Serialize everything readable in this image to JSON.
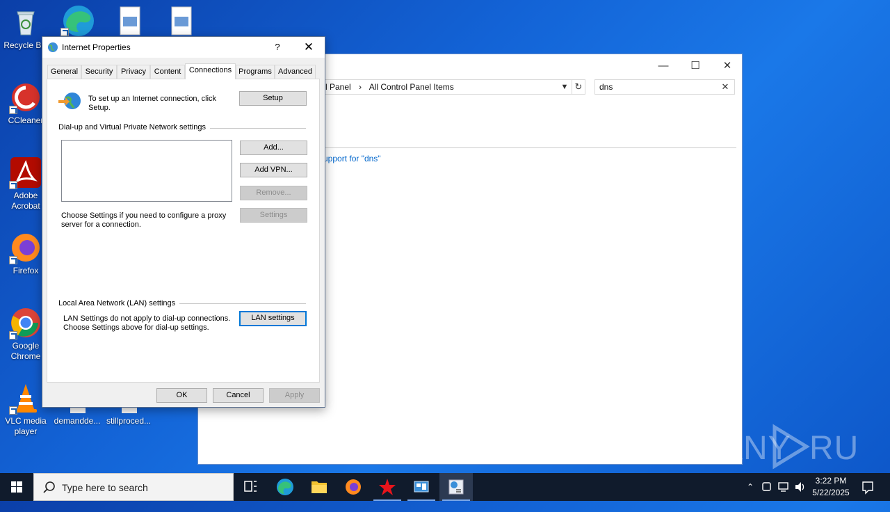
{
  "desktop": {
    "icons": [
      {
        "label": "Recycle Bin"
      },
      {
        "label": "CCleaner"
      },
      {
        "label": "Adobe Acrobat"
      },
      {
        "label": "Firefox"
      },
      {
        "label": "Google Chrome"
      },
      {
        "label": "VLC media player"
      },
      {
        "label": "demandde..."
      },
      {
        "label": "stillproced..."
      }
    ]
  },
  "control_panel": {
    "breadcrumb": [
      "l Panel",
      "All Control Panel Items"
    ],
    "breadcrumb_sep": "›",
    "search_value": "dns",
    "link_text": "upport for \"dns\""
  },
  "dialog": {
    "title": "Internet Properties",
    "help": "?",
    "close": "✕",
    "tabs": [
      {
        "label": "General"
      },
      {
        "label": "Security"
      },
      {
        "label": "Privacy"
      },
      {
        "label": "Content"
      },
      {
        "label": "Connections",
        "active": true
      },
      {
        "label": "Programs"
      },
      {
        "label": "Advanced"
      }
    ],
    "setup_text": "To set up an Internet connection, click Setup.",
    "setup_button": "Setup",
    "dialup_group": "Dial-up and Virtual Private Network settings",
    "add_button": "Add...",
    "add_vpn_button": "Add VPN...",
    "remove_button": "Remove...",
    "settings_button": "Settings",
    "proxy_text": "Choose Settings if you need to configure a proxy server for a connection.",
    "lan_group": "Local Area Network (LAN) settings",
    "lan_text": "LAN Settings do not apply to dial-up connections. Choose Settings above for dial-up settings.",
    "lan_button": "LAN settings",
    "ok_button": "OK",
    "cancel_button": "Cancel",
    "apply_button": "Apply"
  },
  "taskbar": {
    "search_placeholder": "Type here to search",
    "time": "3:22 PM",
    "date": "5/22/2025",
    "apps": [
      "task-view",
      "edge",
      "file-explorer",
      "firefox",
      "red-star-app",
      "network-app",
      "internet-properties"
    ]
  },
  "watermark": "ANY RUN",
  "colors": {
    "accent": "#0078d7",
    "desktop": "#1363d6",
    "taskbar": "#101b2c",
    "link": "#0066cc"
  }
}
